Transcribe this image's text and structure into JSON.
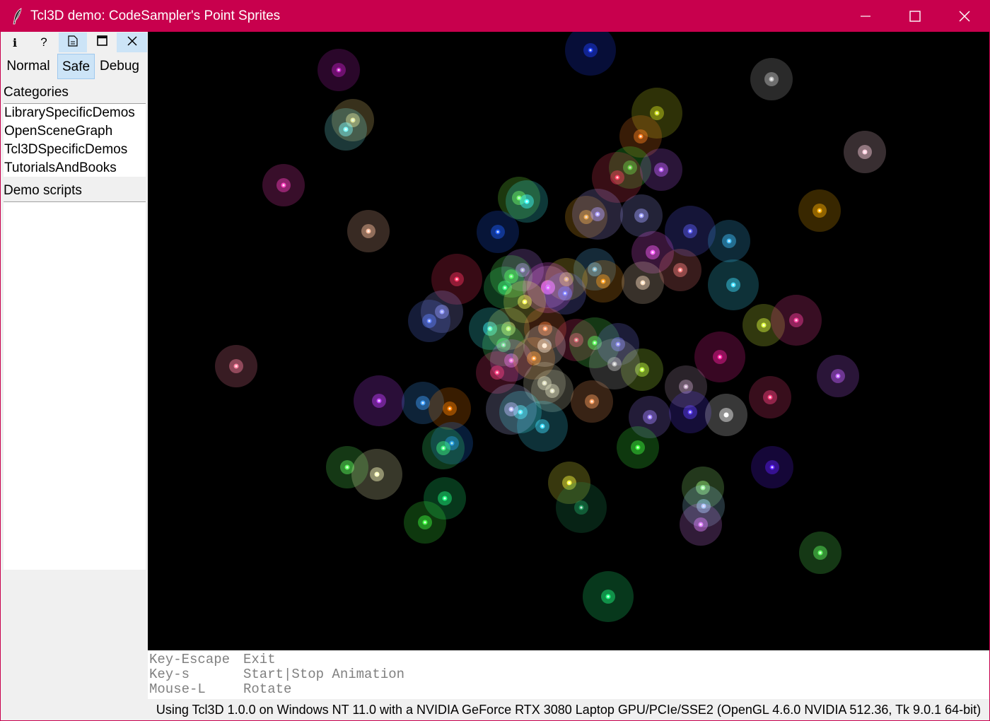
{
  "window": {
    "title": "Tcl3D demo: CodeSampler's Point Sprites",
    "icon": "feather-icon",
    "controls": [
      "minimize-icon",
      "maximize-icon",
      "close-icon"
    ],
    "accent": "#c8004d"
  },
  "toolbar": {
    "buttons": [
      {
        "name": "info",
        "icon": "info-icon",
        "glyph": "i"
      },
      {
        "name": "help",
        "icon": "help-icon",
        "glyph": "?"
      },
      {
        "name": "source",
        "icon": "document-icon"
      },
      {
        "name": "window",
        "icon": "window-icon"
      },
      {
        "name": "close",
        "icon": "close-icon"
      }
    ]
  },
  "modes": {
    "normal": "Normal",
    "safe": "Safe",
    "debug": "Debug",
    "selected": "Safe"
  },
  "categories": {
    "label": "Categories",
    "items": [
      "LibrarySpecificDemos",
      "OpenSceneGraph",
      "Tcl3DSpecificDemos",
      "TutorialsAndBooks"
    ]
  },
  "demos": {
    "label": "Demo scripts",
    "items": []
  },
  "help": {
    "rows": [
      {
        "key": "Key-Escape",
        "action": "Exit"
      },
      {
        "key": "Key-s",
        "action": "Start|Stop Animation"
      },
      {
        "key": "Mouse-L",
        "action": "Rotate"
      }
    ]
  },
  "status": {
    "text": "Using Tcl3D 1.0.0 on Windows NT 11.0 with a NVIDIA GeForce RTX 3080 Laptop GPU/PCIe/SSE2 (OpenGL 4.6.0 NVIDIA 512.36, Tk 9.0.1 64-bit)"
  }
}
